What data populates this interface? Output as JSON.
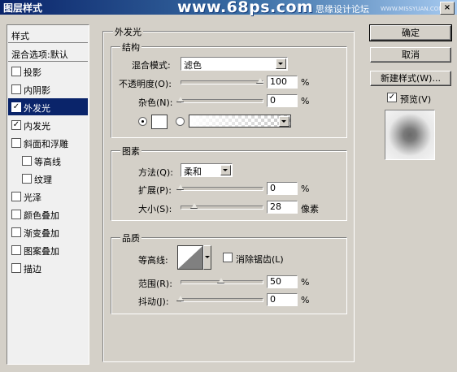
{
  "window": {
    "title": "图层样式",
    "close_label": "×"
  },
  "watermark": {
    "site": "www.68ps.com",
    "forum": "思缘设计论坛",
    "url": "WWW.MISSYUAN.COM"
  },
  "sidebar": {
    "header": "样式",
    "blend_options": "混合选项:默认",
    "items": [
      {
        "label": "投影",
        "checked": false
      },
      {
        "label": "内阴影",
        "checked": false
      },
      {
        "label": "外发光",
        "checked": true,
        "selected": true
      },
      {
        "label": "内发光",
        "checked": true
      },
      {
        "label": "斜面和浮雕",
        "checked": false
      },
      {
        "label": "等高线",
        "checked": false
      },
      {
        "label": "纹理",
        "checked": false
      },
      {
        "label": "光泽",
        "checked": false
      },
      {
        "label": "颜色叠加",
        "checked": false
      },
      {
        "label": "渐变叠加",
        "checked": false
      },
      {
        "label": "图案叠加",
        "checked": false
      },
      {
        "label": "描边",
        "checked": false
      }
    ]
  },
  "main": {
    "title": "外发光",
    "structure": {
      "title": "结构",
      "blend_mode": {
        "label": "混合模式:",
        "value": "滤色"
      },
      "opacity": {
        "label": "不透明度(O):",
        "value": "100",
        "unit": "%"
      },
      "noise": {
        "label": "杂色(N):",
        "value": "0",
        "unit": "%"
      }
    },
    "elements": {
      "title": "图素",
      "technique": {
        "label": "方法(Q):",
        "value": "柔和"
      },
      "spread": {
        "label": "扩展(P):",
        "value": "0",
        "unit": "%"
      },
      "size": {
        "label": "大小(S):",
        "value": "28",
        "unit": "像素"
      }
    },
    "quality": {
      "title": "品质",
      "contour": {
        "label": "等高线:"
      },
      "anti_alias": {
        "label": "消除锯齿(L)",
        "checked": false
      },
      "range": {
        "label": "范围(R):",
        "value": "50",
        "unit": "%"
      },
      "jitter": {
        "label": "抖动(J):",
        "value": "0",
        "unit": "%"
      }
    }
  },
  "buttons": {
    "ok": "确定",
    "cancel": "取消",
    "new_style": "新建样式(W)...",
    "preview": {
      "label": "预览(V)",
      "checked": true
    }
  }
}
